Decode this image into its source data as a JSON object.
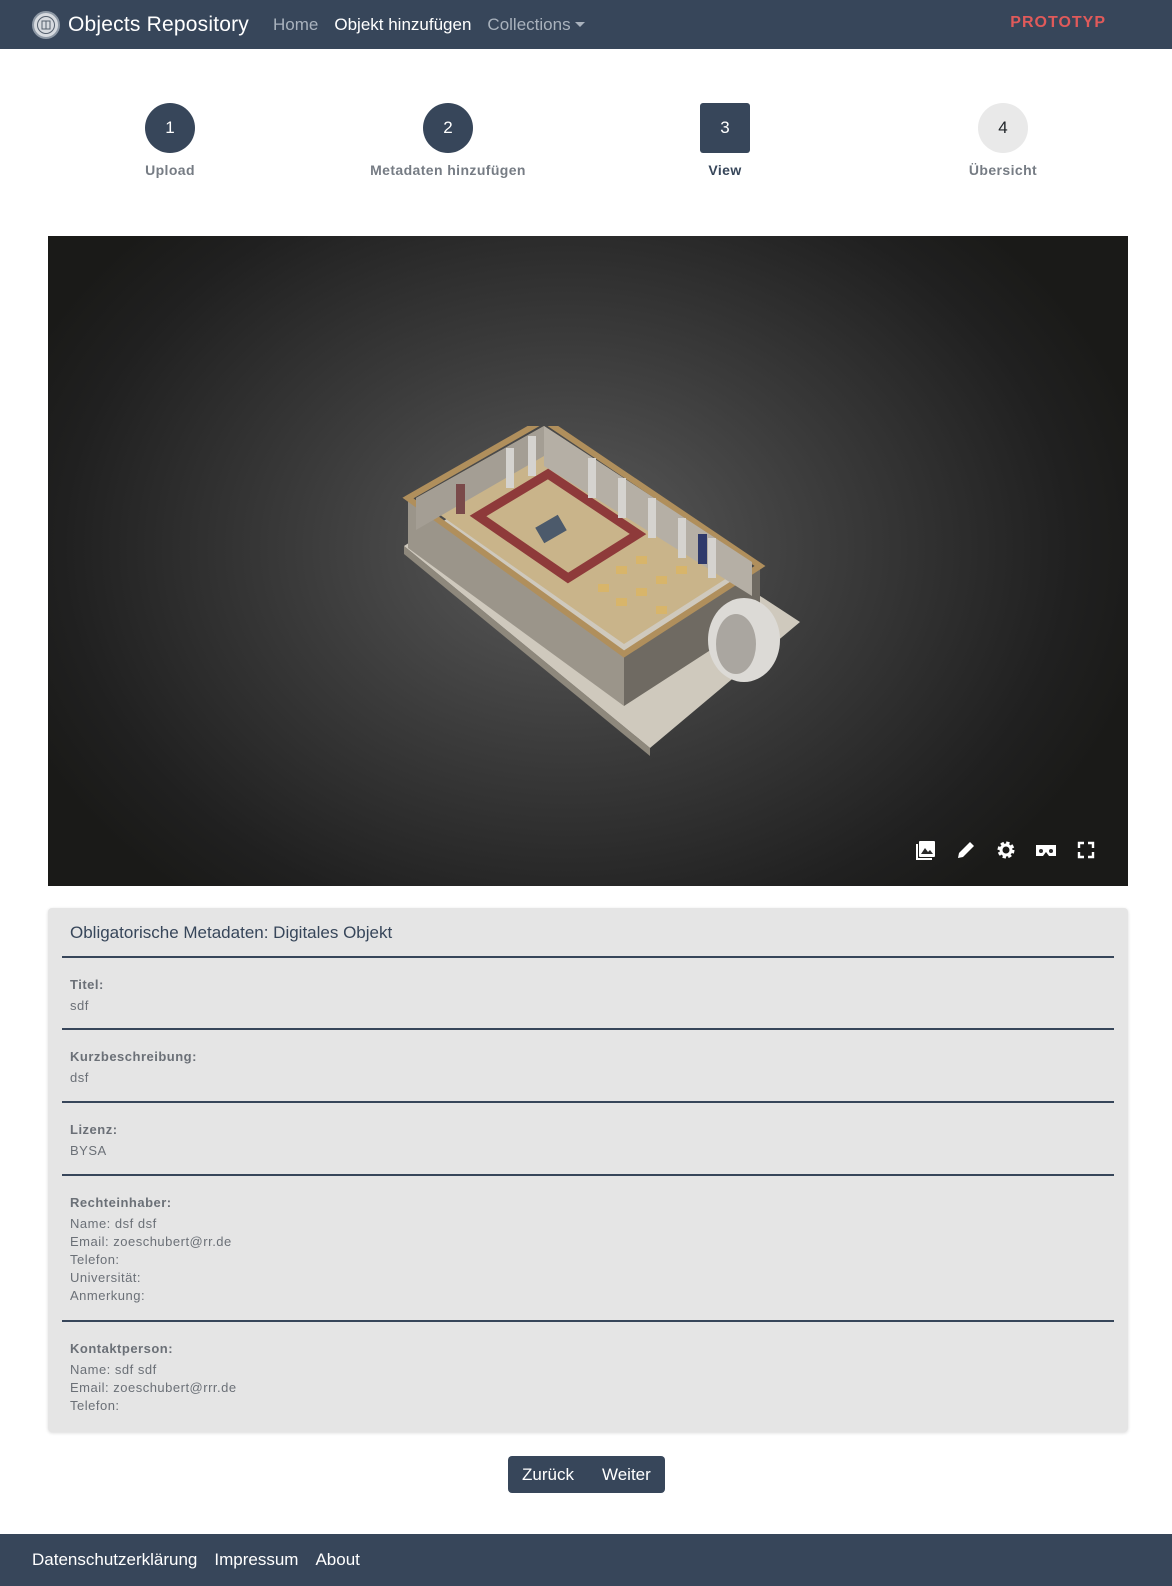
{
  "navbar": {
    "brand": "Objects Repository",
    "links": [
      "Home",
      "Objekt hinzufügen",
      "Collections"
    ],
    "badge": "PROTOTYP"
  },
  "stepper": {
    "steps": [
      {
        "number": "1",
        "label": "Upload"
      },
      {
        "number": "2",
        "label": "Metadaten hinzufügen"
      },
      {
        "number": "3",
        "label": "View"
      },
      {
        "number": "4",
        "label": "Übersicht"
      }
    ],
    "current": 3
  },
  "viewer": {
    "toolbar": [
      "image-icon",
      "pencil-icon",
      "gear-icon",
      "vr-headset-icon",
      "fullscreen-icon"
    ]
  },
  "metadata": {
    "title": "Obligatorische Metadaten: Digitales Objekt",
    "titel": {
      "label": "Titel:",
      "value": "sdf"
    },
    "kurzbeschreibung": {
      "label": "Kurzbeschreibung:",
      "value": "dsf"
    },
    "lizenz": {
      "label": "Lizenz:",
      "value": "BYSA"
    },
    "rechteinhaber": {
      "label": "Rechteinhaber:",
      "lines": [
        "Name: dsf dsf",
        "Email: zoeschubert@rr.de",
        "Telefon:",
        "Universität:",
        "Anmerkung:"
      ]
    },
    "kontaktperson": {
      "label": "Kontaktperson:",
      "lines": [
        "Name: sdf sdf",
        "Email: zoeschubert@rrr.de",
        "Telefon:"
      ]
    }
  },
  "buttons": {
    "back": "Zurück",
    "next": "Weiter"
  },
  "footer": {
    "links": [
      "Datenschutzerklärung",
      "Impressum",
      "About"
    ]
  },
  "colors": {
    "primary": "#37465a",
    "accent": "#e05a5a",
    "card": "#e5e5e5"
  }
}
